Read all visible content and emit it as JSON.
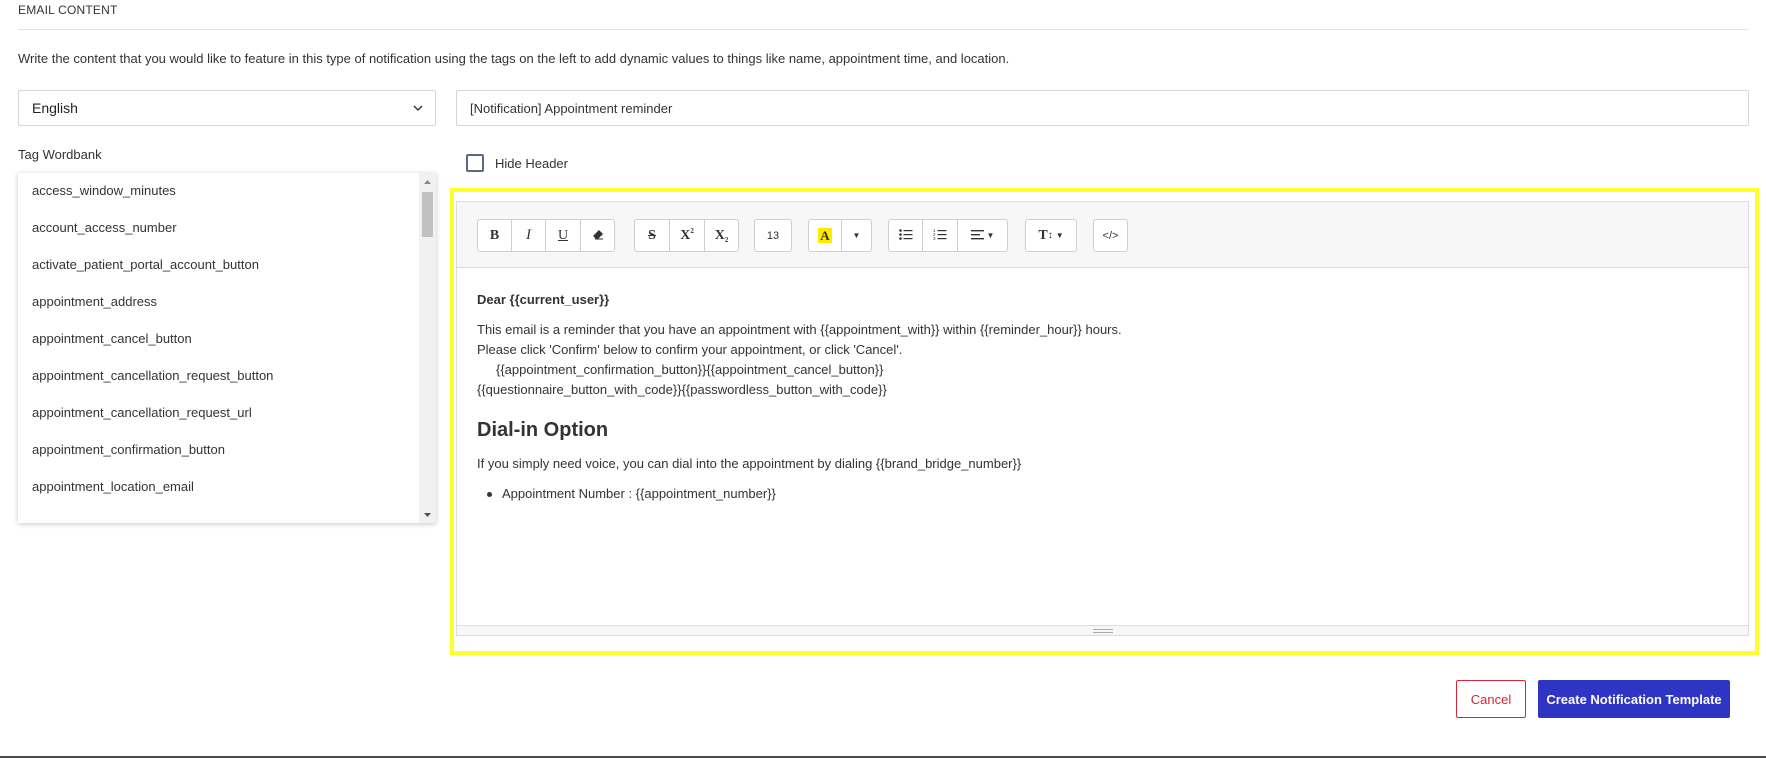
{
  "section": {
    "title": "EMAIL CONTENT",
    "description": "Write the content that you would like to feature in this type of notification using the tags on the left to add dynamic values to things like name, appointment time, and location."
  },
  "language_select": {
    "value": "English"
  },
  "subject": {
    "value": "[Notification] Appointment reminder"
  },
  "wordbank": {
    "label": "Tag Wordbank",
    "items": [
      "access_window_minutes",
      "account_access_number",
      "activate_patient_portal_account_button",
      "appointment_address",
      "appointment_cancel_button",
      "appointment_cancellation_request_button",
      "appointment_cancellation_request_url",
      "appointment_confirmation_button",
      "appointment_location_email"
    ]
  },
  "hide_header": {
    "label": "Hide Header",
    "checked": false
  },
  "toolbar": {
    "bold": "B",
    "italic": "I",
    "underline": "U",
    "strikethrough": "S",
    "superscript": "X",
    "subscript": "X",
    "font_size": "13",
    "highlight": "A",
    "text_style": "T",
    "code_view": "</>"
  },
  "editor": {
    "greeting": "Dear {{current_user}}",
    "line1": "This email is a reminder that you have an appointment with {{appointment_with}} within {{reminder_hour}} hours.",
    "line2": "Please click 'Confirm' below to confirm your appointment, or click 'Cancel'.",
    "line3": "{{appointment_confirmation_button}}{{appointment_cancel_button}}",
    "line4": "{{questionnaire_button_with_code}}{{passwordless_button_with_code}}",
    "heading": "Dial-in Option",
    "dial_in": "If you simply need voice, you can dial into the appointment by dialing {{brand_bridge_number}}",
    "bullet": "Appointment Number : {{appointment_number}}"
  },
  "actions": {
    "cancel": "Cancel",
    "create": "Create Notification Template"
  },
  "colors": {
    "primary": "#2e35c5",
    "danger": "#d72638",
    "highlight_outline": "#ffff2a",
    "highlight_swatch": "#ffeb00"
  }
}
